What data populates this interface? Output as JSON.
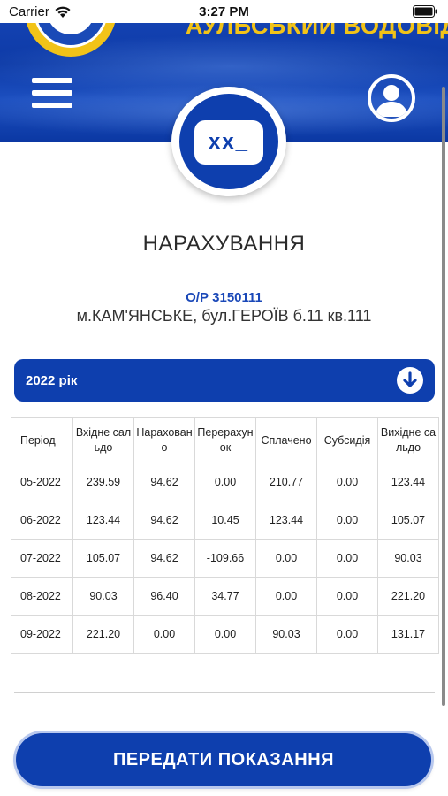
{
  "status_bar": {
    "carrier": "Carrier",
    "time": "3:27 PM"
  },
  "header": {
    "brand_text": "АУЛЬСЬКИЙ ВОДОВІД",
    "menu_icon": "hamburger-menu-icon",
    "profile_icon": "user-profile-icon",
    "colors": {
      "primary": "#0e3fae",
      "accent": "#f2c318"
    }
  },
  "badge": {
    "text": "xx_"
  },
  "page": {
    "title": "НАРАХУВАННЯ"
  },
  "account": {
    "number": "О/Р 3150111",
    "address": "м.КАМ'ЯНСЬКЕ, бул.ГЕРОЇВ б.11 кв.111"
  },
  "year_selector": {
    "label": "2022 рік",
    "icon": "arrow-down-circle-icon"
  },
  "table": {
    "headers": [
      "Період",
      "Вхідне сальдо",
      "Нарахован о",
      "Перерахун ок",
      "Сплачено",
      "Субсидія",
      "Вихідне сальдо"
    ],
    "rows": [
      [
        "05-2022",
        "239.59",
        "94.62",
        "0.00",
        "210.77",
        "0.00",
        "123.44"
      ],
      [
        "06-2022",
        "123.44",
        "94.62",
        "10.45",
        "123.44",
        "0.00",
        "105.07"
      ],
      [
        "07-2022",
        "105.07",
        "94.62",
        "-109.66",
        "0.00",
        "0.00",
        "90.03"
      ],
      [
        "08-2022",
        "90.03",
        "96.40",
        "34.77",
        "0.00",
        "0.00",
        "221.20"
      ],
      [
        "09-2022",
        "221.20",
        "0.00",
        "0.00",
        "90.03",
        "0.00",
        "131.17"
      ]
    ]
  },
  "submit_button": {
    "label": "ПЕРЕДАТИ ПОКАЗАННЯ"
  }
}
